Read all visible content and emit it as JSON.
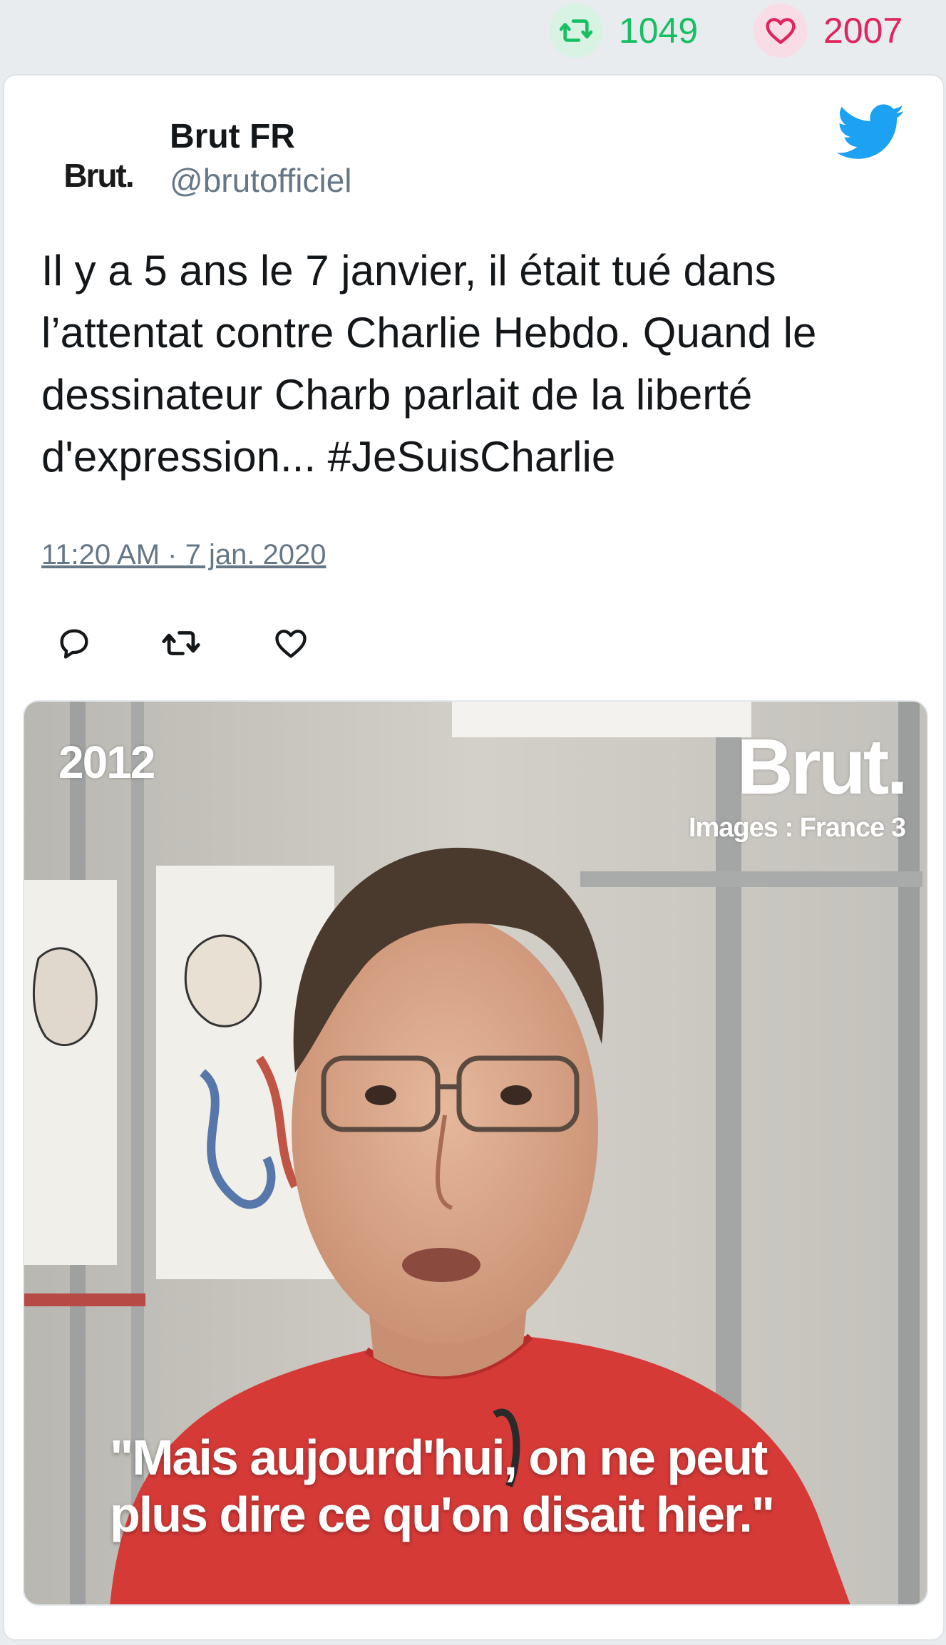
{
  "stats": {
    "retweets": "1049",
    "likes": "2007",
    "retweet_color": "#17bf63",
    "like_color": "#e0245e"
  },
  "tweet": {
    "avatar_text": "Brut.",
    "author_name": "Brut FR",
    "author_handle": "@brutofficiel",
    "platform_icon": "twitter-bird-icon",
    "text": "Il y a 5 ans le 7 janvier, il était tué dans l’attentat contre Charlie Hebdo. Quand le dessinateur Charb parlait de la liberté d'expression... #JeSuisCharlie",
    "timestamp": "11:20 AM · 7 jan. 2020",
    "actions": [
      "reply-icon",
      "retweet-icon",
      "like-icon"
    ]
  },
  "media": {
    "year_overlay": "2012",
    "brand_overlay": "Brut.",
    "credit_overlay": "Images : France 3",
    "caption_line1": "\"Mais aujourd'hui, on ne peut",
    "caption_line2": "plus dire ce qu'on disait hier.\"",
    "shirt_color": "#d63a37"
  }
}
